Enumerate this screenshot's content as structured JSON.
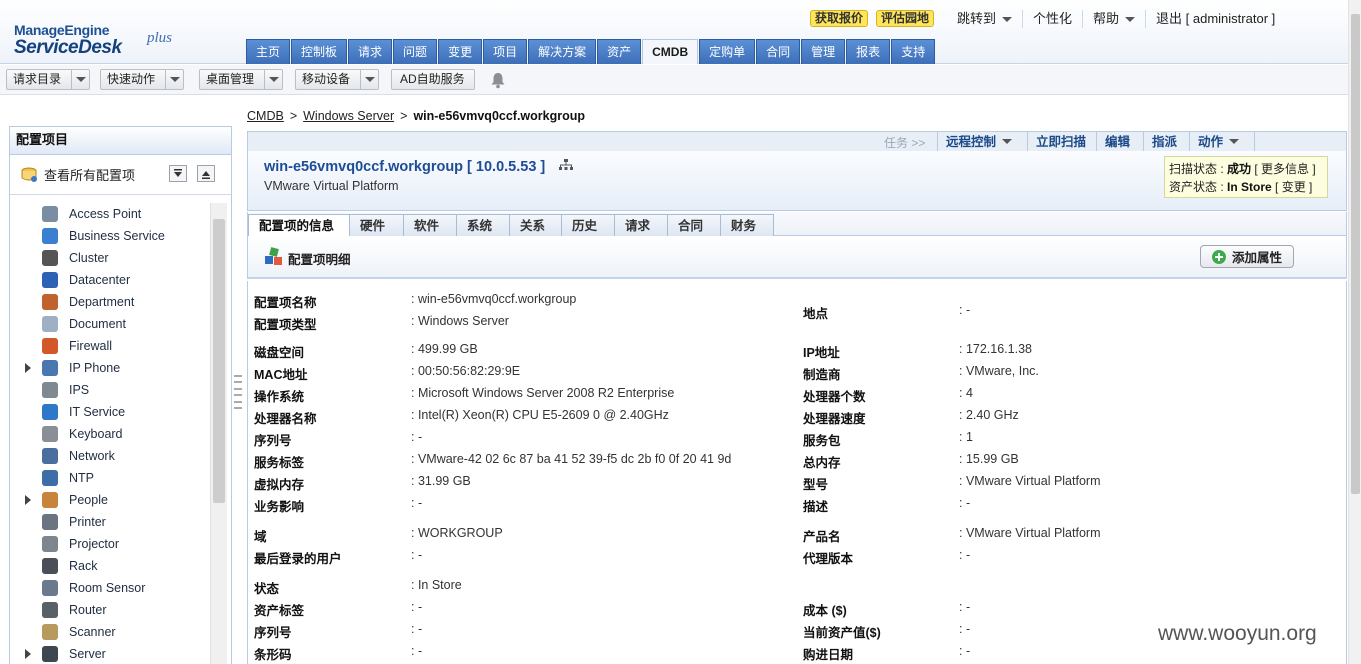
{
  "header": {
    "logo": {
      "line1": "ManageEngine",
      "line2": "ServiceDesk",
      "plus": "plus"
    },
    "promo": [
      "获取报价",
      "评估园地"
    ],
    "toplinks": [
      {
        "label": "跳转到",
        "caret": true
      },
      {
        "label": "个性化",
        "caret": false
      },
      {
        "label": "帮助",
        "caret": true
      },
      {
        "label": "退出 [ administrator ]",
        "caret": false
      }
    ],
    "main_tabs": [
      "主页",
      "控制板",
      "请求",
      "问题",
      "变更",
      "项目",
      "解决方案",
      "资产",
      "CMDB",
      "定购单",
      "合同",
      "管理",
      "报表",
      "支持"
    ],
    "active_tab": "CMDB"
  },
  "toolbar": {
    "buttons": [
      "请求目录",
      "快速动作",
      "桌面管理",
      "移动设备"
    ],
    "ad_button": "AD自助服务"
  },
  "sidebar": {
    "title": "配置项目",
    "view_all": "查看所有配置项",
    "items": [
      {
        "label": "Access Point",
        "icon": "antenna-icon",
        "color": "#7a8da3",
        "expandable": false
      },
      {
        "label": "Business Service",
        "icon": "globe-icon",
        "color": "#3b7fd0",
        "expandable": false
      },
      {
        "label": "Cluster",
        "icon": "cluster-icon",
        "color": "#555555",
        "expandable": false
      },
      {
        "label": "Datacenter",
        "icon": "datacenter-icon",
        "color": "#2e62b3",
        "expandable": false
      },
      {
        "label": "Department",
        "icon": "department-icon",
        "color": "#c0622c",
        "expandable": false
      },
      {
        "label": "Document",
        "icon": "document-icon",
        "color": "#9fb0c5",
        "expandable": false
      },
      {
        "label": "Firewall",
        "icon": "firewall-icon",
        "color": "#d2582a",
        "expandable": false
      },
      {
        "label": "IP Phone",
        "icon": "ip-phone-icon",
        "color": "#4a77b0",
        "expandable": true
      },
      {
        "label": "IPS",
        "icon": "ips-icon",
        "color": "#808890",
        "expandable": false
      },
      {
        "label": "IT Service",
        "icon": "it-service-icon",
        "color": "#2f78c9",
        "expandable": false
      },
      {
        "label": "Keyboard",
        "icon": "keyboard-icon",
        "color": "#8a8f96",
        "expandable": false
      },
      {
        "label": "Network",
        "icon": "network-icon",
        "color": "#4b6e9e",
        "expandable": false
      },
      {
        "label": "NTP",
        "icon": "ntp-icon",
        "color": "#3d6ea8",
        "expandable": false
      },
      {
        "label": "People",
        "icon": "people-icon",
        "color": "#c8843a",
        "expandable": true
      },
      {
        "label": "Printer",
        "icon": "printer-icon",
        "color": "#6b7480",
        "expandable": false
      },
      {
        "label": "Projector",
        "icon": "projector-icon",
        "color": "#7d858f",
        "expandable": false
      },
      {
        "label": "Rack",
        "icon": "rack-icon",
        "color": "#4a4f57",
        "expandable": false
      },
      {
        "label": "Room Sensor",
        "icon": "room-sensor-icon",
        "color": "#6a7a8c",
        "expandable": false
      },
      {
        "label": "Router",
        "icon": "router-icon",
        "color": "#5a6068",
        "expandable": false
      },
      {
        "label": "Scanner",
        "icon": "scanner-icon",
        "color": "#b89a5e",
        "expandable": false
      },
      {
        "label": "Server",
        "icon": "server-icon",
        "color": "#3e4650",
        "expandable": true
      }
    ]
  },
  "breadcrumb": {
    "items": [
      "CMDB",
      "Windows Server"
    ],
    "current": "win-e56vmvq0ccf.workgroup"
  },
  "actions": {
    "tasks": "任务 >>",
    "remote": "远程控制",
    "scan": "立即扫描",
    "edit": "编辑",
    "assign": "指派",
    "action": "动作"
  },
  "ci": {
    "title": "win-e56vmvq0ccf.workgroup [ 10.0.5.53 ]",
    "subtitle": "VMware Virtual Platform",
    "scan_status_label": "扫描状态 :",
    "scan_status_value": "成功",
    "more_info": "[ 更多信息 ]",
    "asset_status_label": "资产状态 :",
    "asset_status_value": "In Store",
    "change": "[ 变更 ]"
  },
  "subtabs": [
    "配置项的信息",
    "硬件",
    "软件",
    "系统",
    "关系",
    "历史",
    "请求",
    "合同",
    "财务"
  ],
  "detail": {
    "title": "配置项明细",
    "add_button": "添加属性",
    "left": [
      {
        "label": "配置项名称",
        "value": ": win-e56vmvq0ccf.workgroup"
      },
      {
        "label": "配置项类型",
        "value": ": Windows Server"
      },
      {
        "label": "磁盘空间",
        "value": ": 499.99 GB"
      },
      {
        "label": "MAC地址",
        "value": ": 00:50:56:82:29:9E"
      },
      {
        "label": "操作系统",
        "value": ": Microsoft Windows Server 2008 R2 Enterprise"
      },
      {
        "label": "处理器名称",
        "value": ": Intel(R) Xeon(R) CPU E5-2609 0 @ 2.40GHz"
      },
      {
        "label": "序列号",
        "value": ": -"
      },
      {
        "label": "服务标签",
        "value": ": VMware-42 02 6c 87 ba 41 52 39-f5 dc 2b f0 0f 20 41 9d"
      },
      {
        "label": "虚拟内存",
        "value": ": 31.99 GB"
      },
      {
        "label": "业务影响",
        "value": ": -"
      },
      {
        "label": "域",
        "value": ": WORKGROUP"
      },
      {
        "label": "最后登录的用户",
        "value": ": -"
      },
      {
        "label": "状态",
        "value": ": In Store"
      },
      {
        "label": "资产标签",
        "value": ": -"
      },
      {
        "label": "序列号",
        "value": ": -"
      },
      {
        "label": "条形码",
        "value": ": -"
      }
    ],
    "right": [
      {
        "label": "地点",
        "value": ": -"
      },
      {
        "label": "IP地址",
        "value": ": 172.16.1.38"
      },
      {
        "label": "制造商",
        "value": ": VMware, Inc."
      },
      {
        "label": "处理器个数",
        "value": ": 4"
      },
      {
        "label": "处理器速度",
        "value": ": 2.40 GHz"
      },
      {
        "label": "服务包",
        "value": ": 1"
      },
      {
        "label": "总内存",
        "value": ": 15.99 GB"
      },
      {
        "label": "型号",
        "value": ": VMware Virtual Platform"
      },
      {
        "label": "描述",
        "value": ": -"
      },
      {
        "label": "产品名",
        "value": ": VMware Virtual Platform"
      },
      {
        "label": "代理版本",
        "value": ": -"
      },
      {
        "label": "成本 ($)",
        "value": ": -"
      },
      {
        "label": "当前资产值($)",
        "value": ": -"
      },
      {
        "label": "购进日期",
        "value": ": -"
      }
    ]
  },
  "watermark": "www.wooyun.org"
}
